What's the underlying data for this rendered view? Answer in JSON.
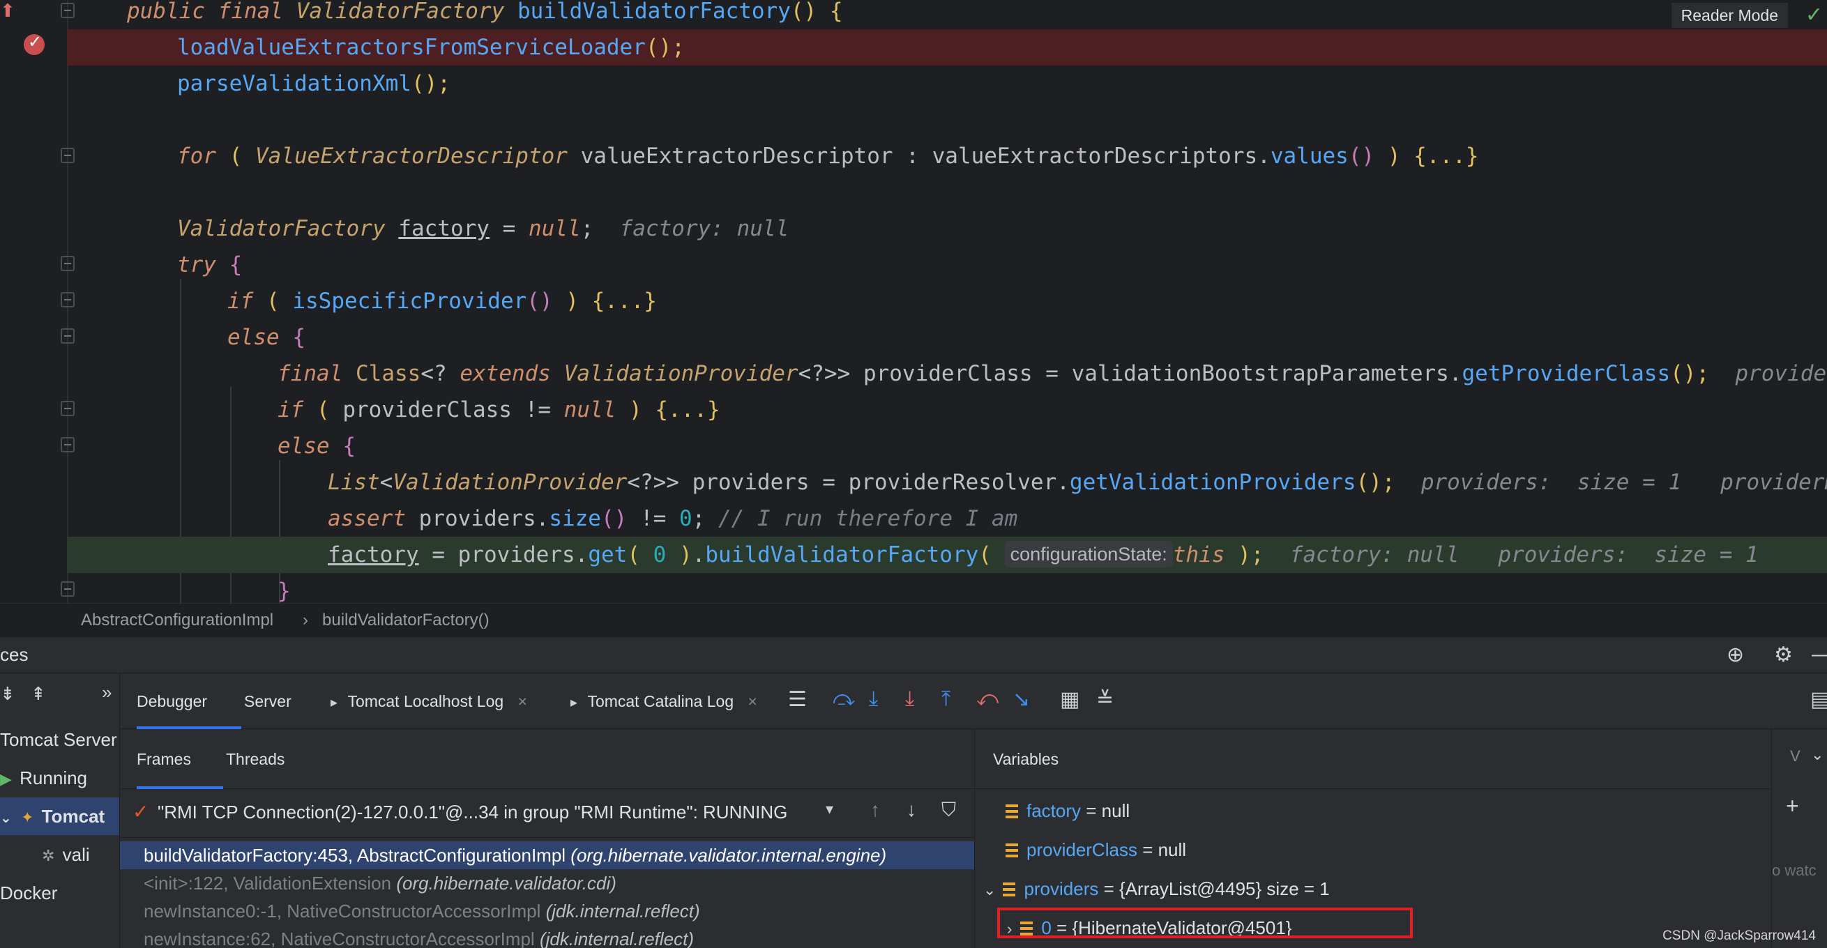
{
  "editor": {
    "reader_mode": "Reader Mode",
    "lines": {
      "l1": {
        "public": "public",
        "final": "final",
        "type": "ValidatorFactory",
        "name": "buildValidatorFactory",
        "tail": "() {"
      },
      "l2": {
        "call": "loadValueExtractorsFromServiceLoader",
        "tail": "();"
      },
      "l3": {
        "call": "parseValidationXml",
        "tail": "();"
      },
      "l4": {
        "for": "for",
        "open": "(",
        "type": "ValueExtractorDescriptor",
        "var": "valueExtractorDescriptor",
        "colon": ":",
        "coll": "valueExtractorDescriptors",
        "dot": ".",
        "method": "values",
        "paren": "()",
        "close": ")",
        "fold": "{...}"
      },
      "l5": {
        "type": "ValidatorFactory",
        "var": "factory",
        "eq": "=",
        "null": "null",
        "semi": ";",
        "hint": "factory: null"
      },
      "l6": {
        "try": "try",
        "brace": "{"
      },
      "l7": {
        "if": "if",
        "open": "(",
        "call": "isSpecificProvider",
        "paren": "()",
        "close": ")",
        "fold": "{...}"
      },
      "l8": {
        "else": "else",
        "brace": "{"
      },
      "l9": {
        "final": "final",
        "type": "Class",
        "generic1": "<?",
        "extends": "extends",
        "type2": "ValidationProvider",
        "generic2": "<?>>",
        "var": "providerClass",
        "eq": "=",
        "obj": "validationBootstrapParameters",
        "dot": ".",
        "method": "getProviderClass",
        "tail": "();",
        "hint": "providerCla"
      },
      "l10": {
        "if": "if",
        "open": "(",
        "var": "providerClass",
        "ne": "!=",
        "null": "null",
        "close": ")",
        "fold": "{...}"
      },
      "l11": {
        "else": "else",
        "brace": "{"
      },
      "l12": {
        "type": "List",
        "lt": "<",
        "type2": "ValidationProvider",
        "generic": "<?>>",
        "var": "providers",
        "eq": "=",
        "obj": "providerResolver",
        "dot": ".",
        "method": "getValidationProviders",
        "tail": "();",
        "hint1": "providers:  size = 1",
        "hint2": "providerReso"
      },
      "l13": {
        "assert": "assert",
        "var": "providers",
        "dot": ".",
        "method": "size",
        "paren": "()",
        "ne": "!=",
        "num": "0",
        "semi": ";",
        "comment": "// I run therefore I am"
      },
      "l14": {
        "var": "factory",
        "eq": "=",
        "obj": "providers",
        "dot": ".",
        "method": "get",
        "open": "(",
        "num": "0",
        "close": ")",
        "dot2": ".",
        "method2": "buildValidatorFactory",
        "open2": "(",
        "param_hint": "configurationState:",
        "this": "this",
        "close2": ");",
        "hint1": "factory: null",
        "hint2": "providers:  size = 1"
      },
      "l15": {
        "brace": "}"
      }
    },
    "breadcrumb": {
      "class": "AbstractConfigurationImpl",
      "sep": "›",
      "method": "buildValidatorFactory()"
    }
  },
  "services": {
    "title": "ces",
    "tree": [
      {
        "label": "Tomcat Server"
      },
      {
        "label": "Running"
      },
      {
        "label": "Tomcat"
      },
      {
        "label": "vali"
      },
      {
        "label": "Docker"
      }
    ],
    "tabs": {
      "debugger": "Debugger",
      "server": "Server",
      "localhost_log": "Tomcat Localhost Log",
      "catalina_log": "Tomcat Catalina Log"
    },
    "frames_tab": "Frames",
    "threads_tab": "Threads",
    "thread": "\"RMI TCP Connection(2)-127.0.0.1\"@...34 in group \"RMI Runtime\": RUNNING",
    "frames": [
      {
        "method": "buildValidatorFactory:453, AbstractConfigurationImpl",
        "pkg": "(org.hibernate.validator.internal.engine)"
      },
      {
        "method": "<init>:122, ValidationExtension",
        "pkg": "(org.hibernate.validator.cdi)"
      },
      {
        "method": "newInstance0:-1, NativeConstructorAccessorImpl",
        "pkg": "(jdk.internal.reflect)"
      },
      {
        "method": "newInstance:62, NativeConstructorAccessorImpl",
        "pkg": "(jdk.internal.reflect)"
      }
    ],
    "variables_title": "Variables",
    "variables": [
      {
        "name": "factory",
        "value": "= null"
      },
      {
        "name": "providerClass",
        "value": "= null"
      },
      {
        "name": "providers",
        "value": "= {ArrayList@4495}  size = 1"
      },
      {
        "name": "0",
        "value": "= {HibernateValidator@4501}"
      }
    ],
    "watch_label": "V",
    "watch_hint": "o watc",
    "watermark": "CSDN @JackSparrow414"
  },
  "colors": {
    "accent": "#3574f0",
    "breakpoint_line": "#4e1f22",
    "highlight_box": "#e02020"
  }
}
